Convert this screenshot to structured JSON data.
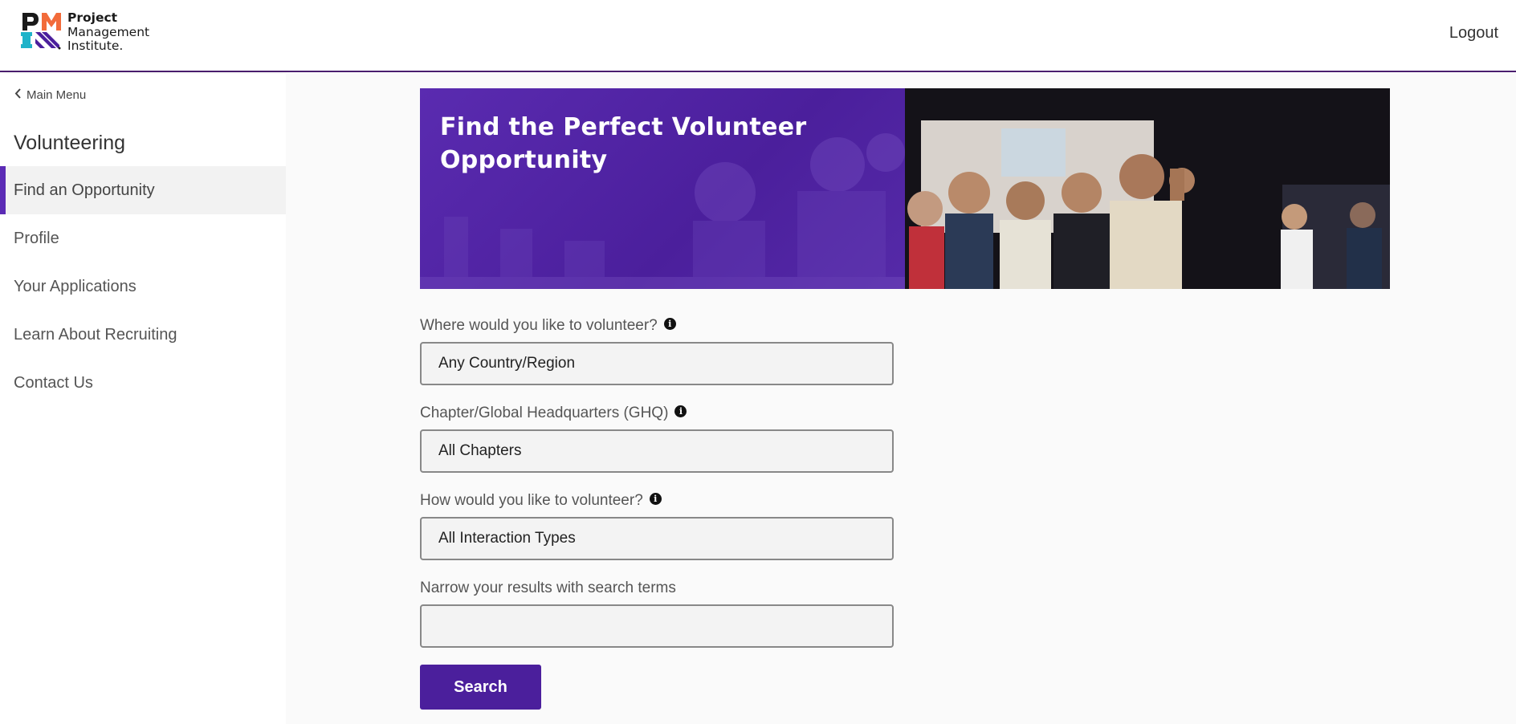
{
  "header": {
    "logo_line1": "Project",
    "logo_line2": "Management",
    "logo_line3": "Institute.",
    "logout_label": "Logout"
  },
  "sidebar": {
    "main_menu_label": "Main Menu",
    "section_title": "Volunteering",
    "items": [
      {
        "label": "Find an Opportunity",
        "active": true
      },
      {
        "label": "Profile"
      },
      {
        "label": "Your Applications"
      },
      {
        "label": "Learn About Recruiting"
      },
      {
        "label": "Contact Us"
      }
    ]
  },
  "banner": {
    "title_line1": "Find the Perfect Volunteer",
    "title_line2": "Opportunity"
  },
  "form": {
    "location": {
      "label": "Where would you like to volunteer?",
      "value": "Any Country/Region"
    },
    "chapter": {
      "label": "Chapter/Global Headquarters (GHQ)",
      "value": "All Chapters"
    },
    "interaction": {
      "label": "How would you like to volunteer?",
      "value": "All Interaction Types"
    },
    "search_terms": {
      "label": "Narrow your results with search terms",
      "value": ""
    },
    "search_label": "Search"
  },
  "colors": {
    "brand_purple": "#4b1f9c",
    "accent_bar": "#5b2bb5",
    "header_border": "#4a1d6e"
  }
}
